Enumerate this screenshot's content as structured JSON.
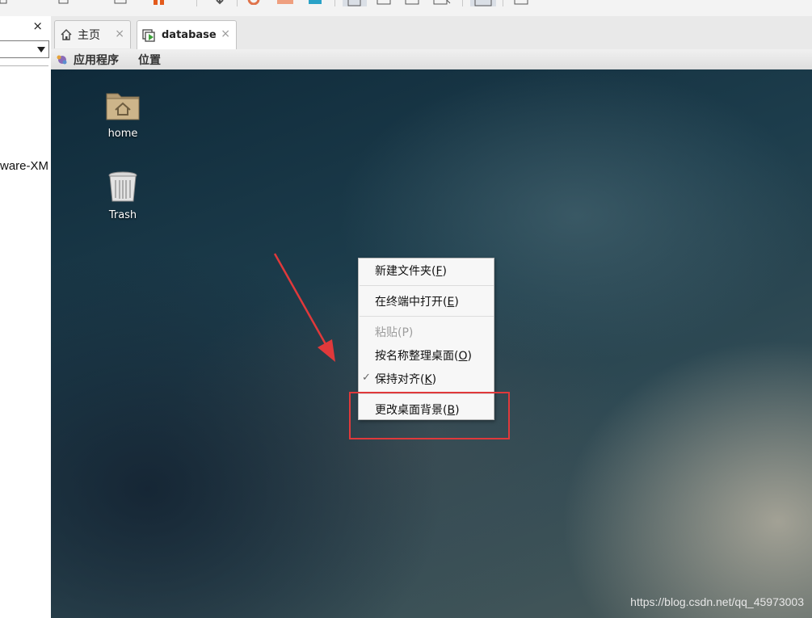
{
  "toolbar": {
    "icons": [
      "vm-icon",
      "power-icon",
      "snapshot-icon",
      "revert-icon",
      "manage-icon",
      "view-normal-icon",
      "view-fullscreen-icon",
      "view-unity-icon",
      "view-stretch-icon",
      "console-icon",
      "help-icon"
    ]
  },
  "library": {
    "close_label": "×",
    "item_label": "ware-XM"
  },
  "tabs": [
    {
      "label": "主页",
      "close": "×"
    },
    {
      "label": "database",
      "close": "×"
    }
  ],
  "guest_menu": {
    "applications": "应用程序",
    "places": "位置"
  },
  "desktop": {
    "icons": [
      {
        "label": "home"
      },
      {
        "label": "Trash"
      }
    ]
  },
  "context_menu": {
    "items": [
      {
        "text": "新建文件夹(",
        "key": "F",
        "tail": ")"
      },
      {
        "text": "在终端中打开(",
        "key": "E",
        "tail": ")"
      },
      {
        "text": "粘贴(P)",
        "key": "",
        "tail": ""
      },
      {
        "text": "按名称整理桌面(",
        "key": "O",
        "tail": ")"
      },
      {
        "text": "保持对齐(",
        "key": "K",
        "tail": ")"
      },
      {
        "text": "更改桌面背景(",
        "key": "B",
        "tail": ")"
      }
    ],
    "check_mark": "✓"
  },
  "watermark": "https://blog.csdn.net/qq_45973003",
  "colors": {
    "highlight": "#e0393b",
    "arrow": "#e0393b"
  }
}
